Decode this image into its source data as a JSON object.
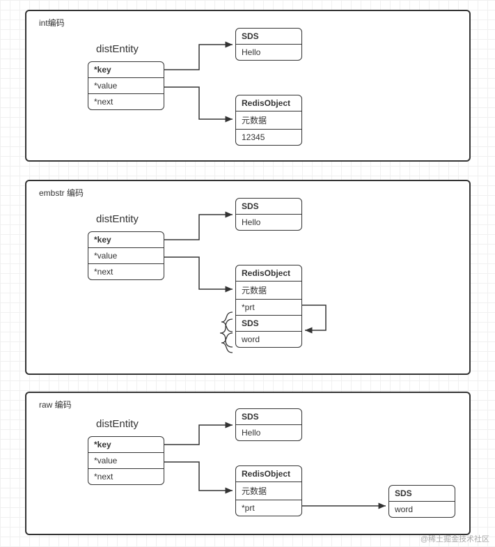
{
  "watermark": "@稀土掘金技术社区",
  "panels": {
    "p1": {
      "title": "int编码"
    },
    "p2": {
      "title": "embstr 编码"
    },
    "p3": {
      "title": "raw 编码"
    }
  },
  "common": {
    "distEntity": "distEntity",
    "key": "*key",
    "value": "*value",
    "next": "*next",
    "sds": "SDS",
    "hello": "Hello",
    "redisObject": "RedisObject",
    "meta": "元数据",
    "prt": "*prt",
    "word": "word",
    "num": "12345"
  }
}
